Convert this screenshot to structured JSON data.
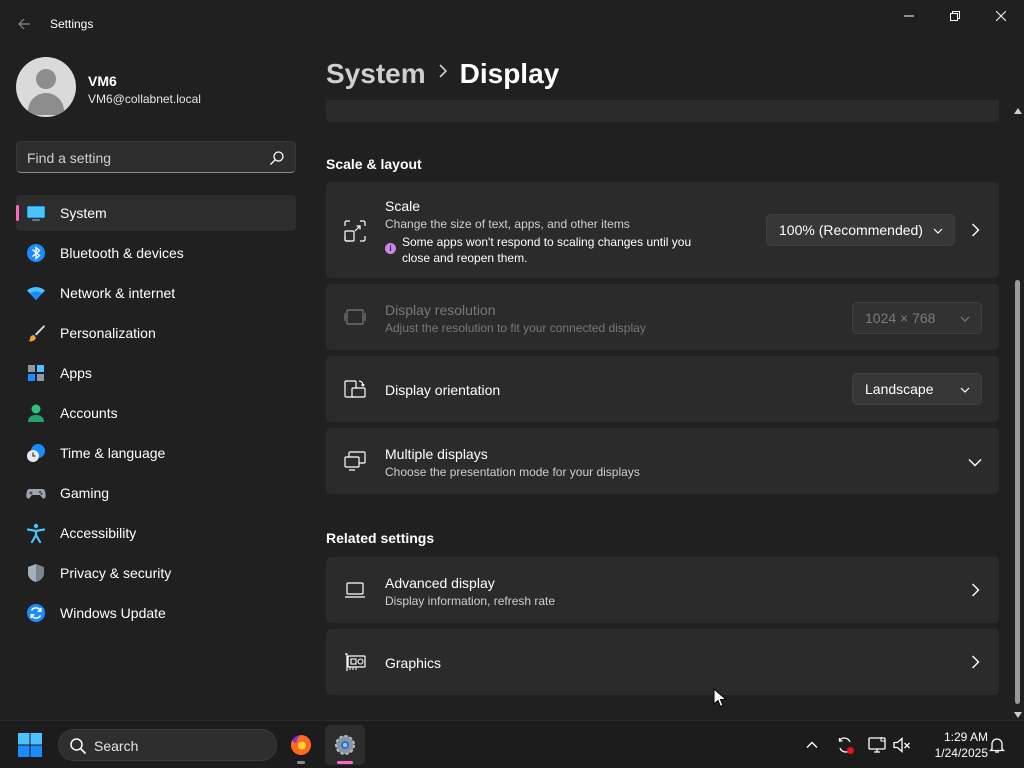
{
  "window": {
    "title": "Settings"
  },
  "user": {
    "name": "VM6",
    "email": "VM6@collabnet.local"
  },
  "sidebar": {
    "search_placeholder": "Find a setting",
    "items": [
      {
        "label": "System",
        "icon": "system-icon",
        "active": true
      },
      {
        "label": "Bluetooth & devices",
        "icon": "bluetooth-icon"
      },
      {
        "label": "Network & internet",
        "icon": "wifi-icon"
      },
      {
        "label": "Personalization",
        "icon": "brush-icon"
      },
      {
        "label": "Apps",
        "icon": "apps-icon"
      },
      {
        "label": "Accounts",
        "icon": "person-icon"
      },
      {
        "label": "Time & language",
        "icon": "clock-globe-icon"
      },
      {
        "label": "Gaming",
        "icon": "gamepad-icon"
      },
      {
        "label": "Accessibility",
        "icon": "accessibility-icon"
      },
      {
        "label": "Privacy & security",
        "icon": "shield-icon"
      },
      {
        "label": "Windows Update",
        "icon": "update-icon"
      }
    ]
  },
  "breadcrumb": {
    "parent": "System",
    "current": "Display"
  },
  "scale_layout": {
    "heading": "Scale & layout",
    "scale": {
      "title": "Scale",
      "subtitle": "Change the size of text, apps, and other items",
      "warning": "Some apps won't respond to scaling changes until you close and reopen them.",
      "value": "100% (Recommended)"
    },
    "resolution": {
      "title": "Display resolution",
      "subtitle": "Adjust the resolution to fit your connected display",
      "value": "1024 × 768"
    },
    "orientation": {
      "title": "Display orientation",
      "value": "Landscape"
    },
    "multiple": {
      "title": "Multiple displays",
      "subtitle": "Choose the presentation mode for your displays"
    }
  },
  "related": {
    "heading": "Related settings",
    "advanced": {
      "title": "Advanced display",
      "subtitle": "Display information, refresh rate"
    },
    "graphics": {
      "title": "Graphics"
    }
  },
  "taskbar": {
    "search_label": "Search",
    "time": "1:29 AM",
    "date": "1/24/2025"
  },
  "colors": {
    "accent": "#ff66c4",
    "background": "#202020",
    "card": "#2b2b2b"
  }
}
